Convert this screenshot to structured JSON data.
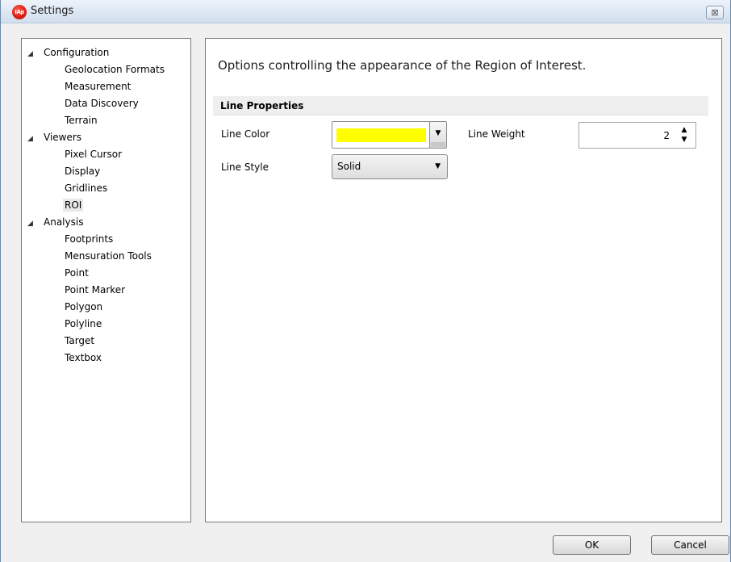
{
  "window": {
    "title": "Settings",
    "app_icon_text": "IAp",
    "close_glyph": "⊠"
  },
  "tree": {
    "groups": [
      {
        "label": "Configuration",
        "expanded": true,
        "children": [
          "Geolocation Formats",
          "Measurement",
          "Data Discovery",
          "Terrain"
        ]
      },
      {
        "label": "Viewers",
        "expanded": true,
        "children": [
          "Pixel Cursor",
          "Display",
          "Gridlines",
          "ROI"
        ]
      },
      {
        "label": "Analysis",
        "expanded": true,
        "children": [
          "Footprints",
          "Mensuration Tools",
          "Point",
          "Point Marker",
          "Polygon",
          "Polyline",
          "Target",
          "Textbox"
        ]
      }
    ],
    "selected": "ROI",
    "expander_glyph": "◢"
  },
  "content": {
    "description": "Options controlling the appearance of the Region of Interest.",
    "section_title": "Line Properties",
    "line_color_label": "Line Color",
    "line_color_value": "#ffff00",
    "line_weight_label": "Line Weight",
    "line_weight_value": "2",
    "line_style_label": "Line Style",
    "line_style_value": "Solid"
  },
  "buttons": {
    "ok": "OK",
    "cancel": "Cancel"
  }
}
